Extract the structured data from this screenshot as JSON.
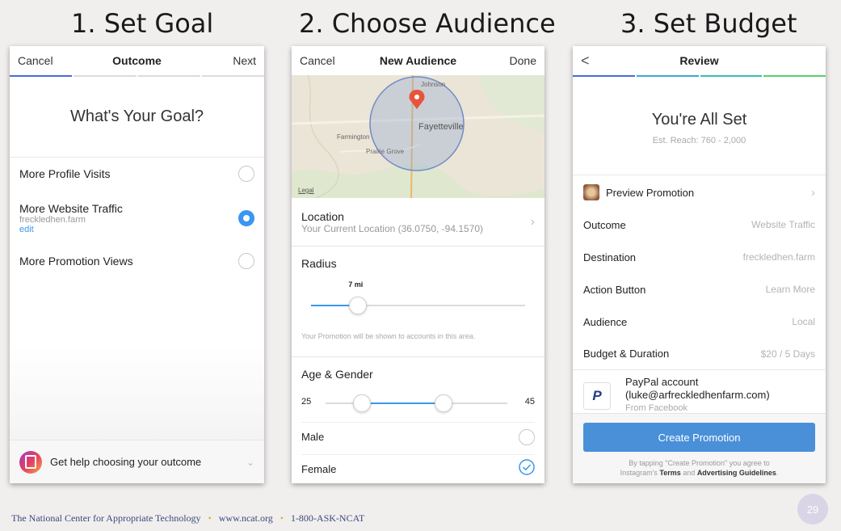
{
  "slide": {
    "step1_title": "1. Set Goal",
    "step2_title": "2. Choose Audience",
    "step3_title": "3. Set Budget",
    "footer_org": "The National Center for Appropriate Technology",
    "footer_url": "www.ncat.org",
    "footer_phone": "1-800-ASK-NCAT",
    "page_number": "29",
    "footer_separator": "•"
  },
  "goal_screen": {
    "nav_left": "Cancel",
    "nav_title": "Outcome",
    "nav_right": "Next",
    "heading": "What's Your Goal?",
    "options": [
      {
        "label": "More Profile Visits",
        "selected": false
      },
      {
        "label": "More Website Traffic",
        "sub": "freckledhen.farm",
        "link": "edit",
        "selected": true
      },
      {
        "label": "More Promotion Views",
        "selected": false
      }
    ],
    "help_text": "Get help choosing your outcome",
    "progress_active_color": "#4a6ad8"
  },
  "audience_screen": {
    "nav_left": "Cancel",
    "nav_title": "New Audience",
    "nav_right": "Done",
    "map_labels": {
      "johnson": "Johnson",
      "fayetteville": "Fayetteville",
      "farmington": "Farmington",
      "prairie_grove": "Prairie Grove",
      "legal": "Legal"
    },
    "location_label": "Location",
    "location_value": "Your Current Location (36.0750, -94.1570)",
    "radius_label": "Radius",
    "radius_value": "7 mi",
    "radius_fraction": 0.22,
    "radius_note": "Your Promotion will be shown to accounts in this area.",
    "age_gender_label": "Age & Gender",
    "age_min": "25",
    "age_max": "45",
    "age_low_fraction": 0.2,
    "age_high_fraction": 0.65,
    "male_label": "Male",
    "male_selected": false,
    "female_label": "Female",
    "female_selected": true
  },
  "review_screen": {
    "nav_back": "<",
    "nav_title": "Review",
    "heading": "You're All Set",
    "reach": "Est. Reach: 760 - 2,000",
    "preview_label": "Preview Promotion",
    "rows": [
      {
        "label": "Outcome",
        "value": "Website Traffic"
      },
      {
        "label": "Destination",
        "value": "freckledhen.farm"
      },
      {
        "label": "Action Button",
        "value": "Learn More"
      },
      {
        "label": "Audience",
        "value": "Local"
      },
      {
        "label": "Budget & Duration",
        "value": "$20 / 5 Days"
      }
    ],
    "paypal_line1": "PayPal account",
    "paypal_line2": "(luke@arfreckledhenfarm.com)",
    "paypal_line3": "From Facebook",
    "cta": "Create Promotion",
    "terms_pre": "By tapping \"Create Promotion\" you agree to",
    "terms_mid_pre": "Instagram's",
    "terms_link1": "Terms",
    "terms_and": "and",
    "terms_link2": "Advertising Guidelines",
    "terms_end": ".",
    "progress_colors": [
      "#4a6ad8",
      "#3fa7d6",
      "#34c1b0",
      "#5ccf6a"
    ]
  }
}
